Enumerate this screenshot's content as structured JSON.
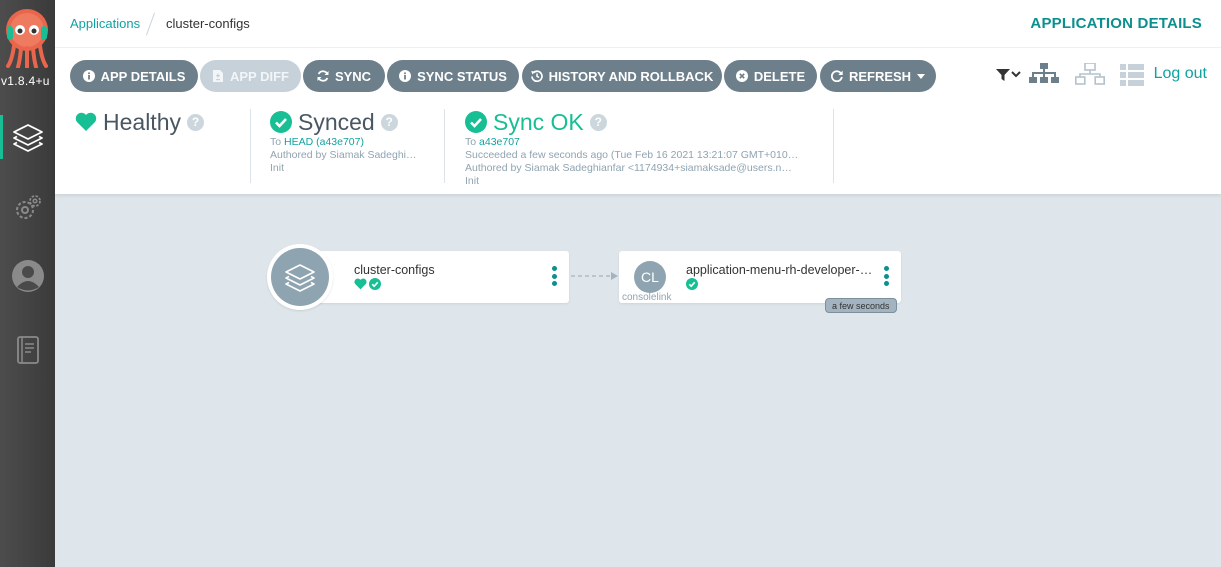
{
  "nav": {
    "version": "v1.8.4+u",
    "items": [
      "applications",
      "settings",
      "user-info",
      "documentation"
    ]
  },
  "breadcrumb": {
    "root": "Applications",
    "current": "cluster-configs"
  },
  "page_title": "APPLICATION DETAILS",
  "toolbar": {
    "buttons": [
      {
        "label": "APP DETAILS",
        "icon": "info-icon"
      },
      {
        "label": "APP DIFF",
        "icon": "file-diff-icon",
        "disabled": true
      },
      {
        "label": "SYNC",
        "icon": "sync-icon"
      },
      {
        "label": "SYNC STATUS",
        "icon": "info-icon"
      },
      {
        "label": "HISTORY AND ROLLBACK",
        "icon": "history-icon"
      },
      {
        "label": "DELETE",
        "icon": "times-circle-icon"
      },
      {
        "label": "REFRESH",
        "icon": "redo-icon",
        "caret": true
      }
    ],
    "logout": "Log out"
  },
  "status": {
    "health": {
      "title": "Healthy"
    },
    "sync": {
      "title": "Synced",
      "to_prefix": "To",
      "revision": "HEAD (a43e707)",
      "author": "Authored by Siamak Sadeghi…",
      "message": "Init"
    },
    "operation": {
      "title": "Sync OK",
      "to_prefix": "To",
      "revision": "a43e707",
      "time": "Succeeded a few seconds ago (Tue Feb 16 2021 13:21:07 GMT+010…",
      "author": "Authored by Siamak Sadeghianfar <1174934+siamaksade@users.n…",
      "message": "Init"
    }
  },
  "graph": {
    "app_node": {
      "name": "cluster-configs"
    },
    "resource_node": {
      "initials": "CL",
      "name": "application-menu-rh-developer-…",
      "kind": "consolelink",
      "age": "a few seconds"
    }
  },
  "colors": {
    "accent": "#18be94",
    "link": "#10a2a2",
    "button": "#6d7f8b",
    "button_disabled": "#c6d1d9",
    "canvas": "#dee6eb",
    "sidebar": "#3a3a3a"
  }
}
